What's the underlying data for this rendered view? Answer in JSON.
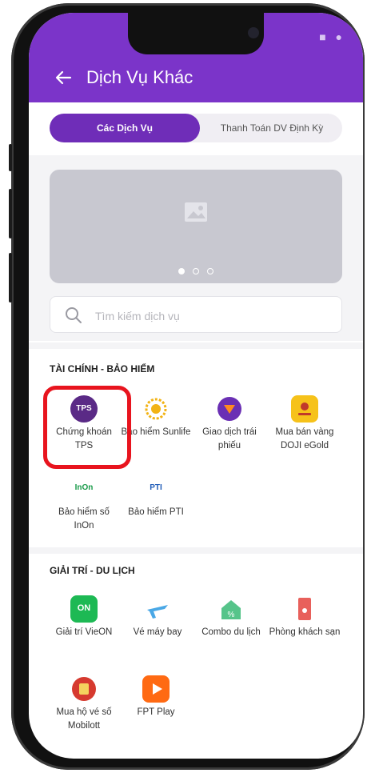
{
  "header": {
    "title": "Dịch Vụ Khác",
    "back_icon": "arrow-left-icon"
  },
  "tabs": [
    {
      "label": "Các Dịch Vụ",
      "active": true
    },
    {
      "label": "Thanh Toán DV Định Kỳ",
      "active": false
    }
  ],
  "banner": {
    "slides": 3,
    "active_slide": 1
  },
  "search": {
    "placeholder": "Tìm kiếm dịch vụ"
  },
  "sections": [
    {
      "title": "TÀI CHÍNH - BẢO HIỂM",
      "items": [
        {
          "label": "Chứng khoán TPS",
          "icon": "tps-logo-icon",
          "logo_text": "TPS",
          "highlighted": true
        },
        {
          "label": "Bảo hiểm Sunlife",
          "icon": "sunlife-logo-icon"
        },
        {
          "label": "Giao dịch trái phiếu",
          "icon": "bond-trade-icon"
        },
        {
          "label": "Mua bán vàng DOJI eGold",
          "icon": "doji-egold-icon"
        },
        {
          "label": "Bảo hiểm số InOn",
          "icon": "inon-logo-icon",
          "logo_text": "InOn"
        },
        {
          "label": "Bảo hiểm PTI",
          "icon": "pti-logo-icon",
          "logo_text": "PTI"
        }
      ]
    },
    {
      "title": "GIẢI TRÍ - DU LỊCH",
      "items": [
        {
          "label": "Giải trí VieON",
          "icon": "vieon-logo-icon",
          "logo_text": "ON"
        },
        {
          "label": "Vé máy bay",
          "icon": "airplane-icon"
        },
        {
          "label": "Combo du lịch",
          "icon": "combo-travel-icon"
        },
        {
          "label": "Phòng khách sạn",
          "icon": "hotel-room-icon"
        },
        {
          "label": "Mua hộ vé số Mobilott",
          "icon": "mobilott-icon"
        },
        {
          "label": "FPT Play",
          "icon": "fpt-play-icon"
        }
      ]
    }
  ],
  "colors": {
    "brand_purple": "#7b34c9",
    "highlight_red": "#e8141e"
  }
}
